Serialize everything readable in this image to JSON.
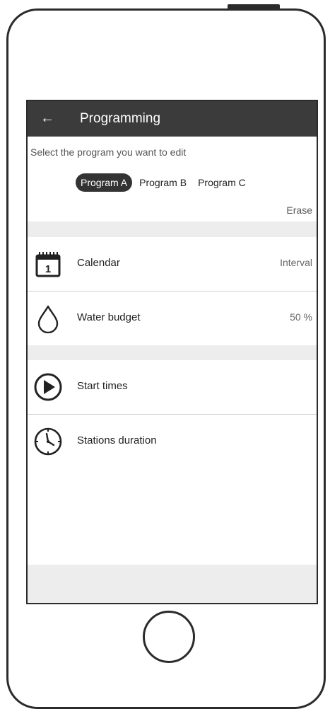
{
  "app": {
    "title": "Programming"
  },
  "selection": {
    "hint": "Select the program you want to edit",
    "programs": [
      "Program A",
      "Program B",
      "Program C"
    ],
    "selected": "Program A",
    "erase_label": "Erase"
  },
  "settings": {
    "calendar": {
      "label": "Calendar",
      "value": "Interval",
      "day_number": "1"
    },
    "water_budget": {
      "label": "Water budget",
      "value": "50 %"
    },
    "start_times": {
      "label": "Start times"
    },
    "stations_duration": {
      "label": "Stations duration"
    }
  },
  "icons": {
    "back": "arrow-left-icon",
    "calendar": "calendar-icon",
    "water_budget": "water-drop-icon",
    "start_times": "play-circle-icon",
    "stations_duration": "clock-icon"
  }
}
